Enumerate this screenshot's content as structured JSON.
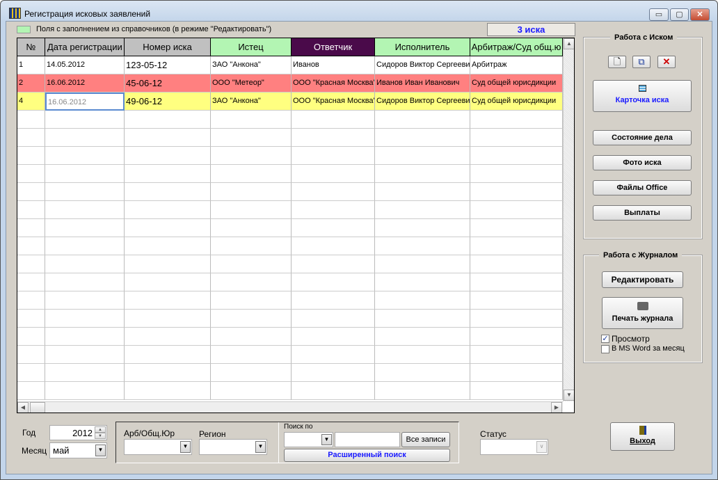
{
  "window": {
    "title": "Регистрация исковых заявлений",
    "min": "▭",
    "max": "▢",
    "close": "✕"
  },
  "legend": {
    "text": "Поля с заполнением из справочников (в режиме \"Редактировать\")",
    "color": "#b3f5b3"
  },
  "count_label": "3 иска",
  "grid": {
    "columns": [
      "№",
      "Дата регистрации",
      "Номер иска",
      "Истец",
      "Ответчик",
      "Исполнитель",
      "Арбитраж/Суд общ.ю"
    ],
    "rows": [
      {
        "c": [
          "1",
          "14.05.2012",
          "123-05-12",
          "ЗАО \"Анкона\"",
          "Иванов",
          "Сидоров Виктор Сергеевич",
          "Арбитраж"
        ],
        "color": "#ffffff"
      },
      {
        "c": [
          "2",
          "16.06.2012",
          "45-06-12",
          "ООО \"Метеор\"",
          "ООО \"Красная Москва\"",
          "Иванов Иван Иванович",
          "Суд общей юрисдикции"
        ],
        "color": "#ff8080"
      },
      {
        "c": [
          "4",
          "16.06.2012",
          "49-06-12",
          "ЗАО \"Анкона\"",
          "ООО \"Красная Москва\"",
          "Сидоров Виктор Сергеевич",
          "Суд общей юрисдикции"
        ],
        "color": "#ffff80"
      }
    ],
    "header_colors": {
      "gray": "#c0c0c0",
      "green": "#b3f5b3",
      "purple": "#4a0a4a"
    }
  },
  "claim_panel": {
    "title": "Работа с Иском",
    "new": "🗋",
    "copy": "⧉",
    "delete": "✕",
    "card": "Карточка иска",
    "state": "Состояние дела",
    "photo": "Фото иска",
    "office": "Файлы Office",
    "payments": "Выплаты"
  },
  "journal_panel": {
    "title": "Работа с Журналом",
    "edit": "Редактировать",
    "print": "Печать журнала",
    "preview": {
      "label": "Просмотр",
      "checked": true
    },
    "word": {
      "label": "В MS Word за месяц",
      "checked": false
    }
  },
  "filters": {
    "year_label": "Год",
    "year": "2012",
    "month_label": "Месяц",
    "month": "май",
    "arb_label": "Арб/Общ.Юр",
    "region_label": "Регион",
    "search_label": "Поиск по",
    "all_records": "Все записи",
    "advanced": "Расширенный поиск",
    "status_label": "Статус"
  },
  "exit": "Выход"
}
